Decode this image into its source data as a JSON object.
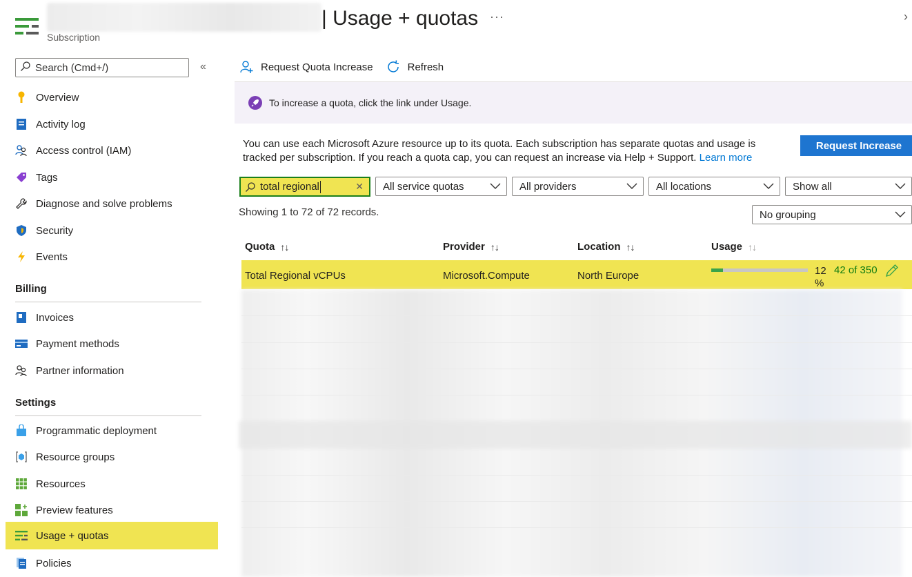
{
  "header": {
    "title": "| Usage + quotas",
    "subtitle": "Subscription",
    "more": "···",
    "expand": "›"
  },
  "sidebar": {
    "search_placeholder": "Search (Cmd+/)",
    "collapse": "«",
    "items": [
      {
        "label": "Overview",
        "icon": "key-icon"
      },
      {
        "label": "Activity log",
        "icon": "activity-log-icon"
      },
      {
        "label": "Access control (IAM)",
        "icon": "people-icon"
      },
      {
        "label": "Tags",
        "icon": "tag-icon"
      },
      {
        "label": "Diagnose and solve problems",
        "icon": "wrench-icon"
      },
      {
        "label": "Security",
        "icon": "shield-icon"
      },
      {
        "label": "Events",
        "icon": "lightning-icon"
      }
    ],
    "billing_heading": "Billing",
    "billing_items": [
      {
        "label": "Invoices",
        "icon": "invoice-icon"
      },
      {
        "label": "Payment methods",
        "icon": "credit-card-icon"
      },
      {
        "label": "Partner information",
        "icon": "partner-icon"
      }
    ],
    "settings_heading": "Settings",
    "settings_items": [
      {
        "label": "Programmatic deployment",
        "icon": "shopping-bag-icon"
      },
      {
        "label": "Resource groups",
        "icon": "resource-group-icon"
      },
      {
        "label": "Resources",
        "icon": "grid-icon"
      },
      {
        "label": "Preview features",
        "icon": "preview-features-icon"
      },
      {
        "label": "Usage + quotas",
        "icon": "usage-quotas-icon",
        "active": true
      },
      {
        "label": "Policies",
        "icon": "policies-icon"
      }
    ]
  },
  "toolbar": {
    "request_quota_increase": "Request Quota Increase",
    "refresh": "Refresh"
  },
  "banner": {
    "text": "To increase a quota, click the link under Usage."
  },
  "description": {
    "text": "You can use each Microsoft Azure resource up to its quota. Each subscription has separate quotas and usage is tracked per subscription. If you reach a quota cap, you can request an increase via Help + Support.",
    "link": "Learn more"
  },
  "request_increase_button": "Request Increase",
  "filters": {
    "search_value": "total regional",
    "service_quotas": "All service quotas",
    "providers": "All providers",
    "locations": "All locations",
    "show": "Show all",
    "grouping": "No grouping"
  },
  "showing_text": "Showing 1 to 72 of 72 records.",
  "table": {
    "columns": [
      "Quota",
      "Provider",
      "Location",
      "Usage"
    ],
    "rows": [
      {
        "quota": "Total Regional vCPUs",
        "provider": "Microsoft.Compute",
        "location": "North Europe",
        "usage_percent_num": "12",
        "usage_percent_sign": "%",
        "usage_fraction": 0.12,
        "usage_text": "42 of 350"
      }
    ]
  },
  "colors": {
    "accent": "#0078d4",
    "highlight": "#f0e452",
    "usage_fill": "#3aa34a"
  }
}
